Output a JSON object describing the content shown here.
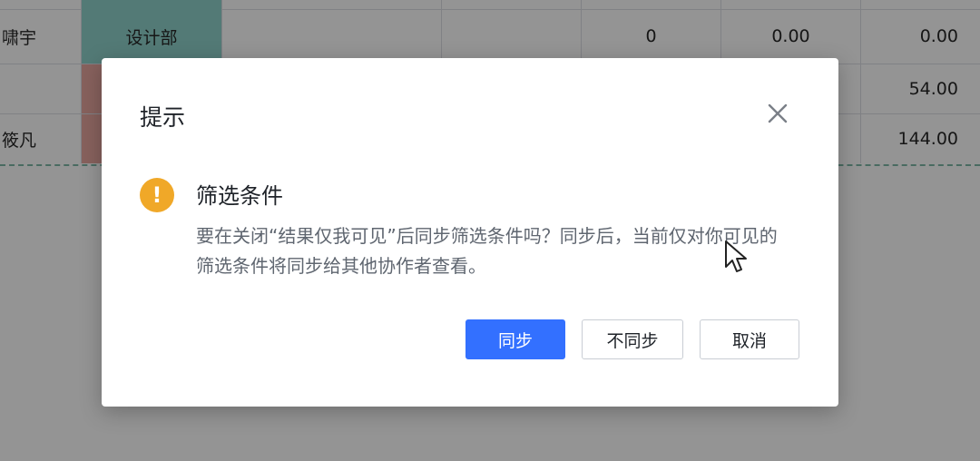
{
  "spreadsheet": {
    "rows": [
      {
        "name": "",
        "dept": "",
        "c5": "",
        "c6": "",
        "c7": ""
      },
      {
        "name": "啸宇",
        "dept": "设计部",
        "c5": "0",
        "c6": "0.00",
        "c7": "0.00"
      },
      {
        "name": "",
        "dept": "",
        "c5": "",
        "c6": "",
        "c7": "54.00"
      },
      {
        "name": "筱凡",
        "dept": "",
        "c5": "",
        "c6": "",
        "c7": "144.00"
      }
    ],
    "colors": {
      "dept_teal": "#8fd3cb",
      "dept_red": "#e8a8a0"
    }
  },
  "dialog": {
    "title": "提示",
    "close_icon": "close-icon",
    "warning_icon": "warning-icon",
    "warning_glyph": "!",
    "heading": "筛选条件",
    "body": "要在关闭“结果仅我可见”后同步筛选条件吗？同步后，当前仅对你可见的筛选条件将同步给其他协作者查看。",
    "buttons": {
      "sync": "同步",
      "no_sync": "不同步",
      "cancel": "取消"
    },
    "colors": {
      "primary": "#3370ff",
      "warning": "#f0a828"
    }
  }
}
